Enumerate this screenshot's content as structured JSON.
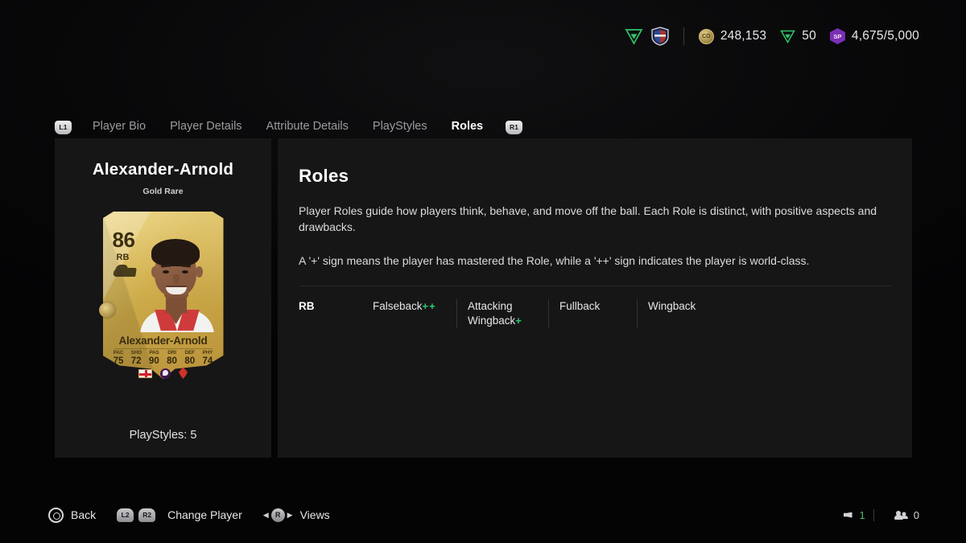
{
  "topbar": {
    "club_points_icon": "fc-points-triangle-icon",
    "club_crest_icon": "club-crest-icon",
    "currencies": [
      {
        "icon": "coins-icon",
        "icon_label": "CO",
        "value": "248,153"
      },
      {
        "icon": "fc-points-icon",
        "icon_label": "",
        "value": "50"
      },
      {
        "icon": "season-points-icon",
        "icon_label": "SP",
        "value": "4,675/5,000"
      }
    ]
  },
  "tabs": {
    "left_shoulder": "L1",
    "right_shoulder": "R1",
    "items": [
      {
        "label": "Player Bio",
        "active": false
      },
      {
        "label": "Player Details",
        "active": false
      },
      {
        "label": "Attribute Details",
        "active": false
      },
      {
        "label": "PlayStyles",
        "active": false
      },
      {
        "label": "Roles",
        "active": true
      }
    ]
  },
  "player": {
    "name": "Alexander-Arnold",
    "rarity": "Gold Rare",
    "playstyles_line": "PlayStyles: 5",
    "card": {
      "rating": "86",
      "position": "RB",
      "name": "Alexander-Arnold",
      "stats": [
        {
          "label": "PAC",
          "value": "75"
        },
        {
          "label": "SHO",
          "value": "72"
        },
        {
          "label": "PAS",
          "value": "90"
        },
        {
          "label": "DRI",
          "value": "80"
        },
        {
          "label": "DEF",
          "value": "80"
        },
        {
          "label": "PHY",
          "value": "74"
        }
      ],
      "nation_icon": "england-flag-icon",
      "league_icon": "premier-league-icon",
      "club_icon": "liverpool-crest-icon"
    }
  },
  "roles_panel": {
    "title": "Roles",
    "paragraph_1": "Player Roles guide how players think, behave, and move off the ball. Each Role is distinct, with positive aspects and drawbacks.",
    "paragraph_2": "A '+' sign means the player has mastered the Role, while a '++' sign indicates the player is world-class.",
    "position": "RB",
    "roles": [
      {
        "name": "Falseback",
        "plus": "++"
      },
      {
        "name": "Attacking\nWingback",
        "plus": "+"
      },
      {
        "name": "Fullback",
        "plus": ""
      },
      {
        "name": "Wingback",
        "plus": ""
      }
    ]
  },
  "bottombar": {
    "back_label": "Back",
    "change_player_label": "Change Player",
    "change_player_buttons": [
      "L2",
      "R2"
    ],
    "views_label": "Views",
    "views_stick": "R",
    "views_arrow_left": "◀",
    "views_arrow_right": "▶",
    "voice_count": "1",
    "friends_count": "0"
  },
  "colors": {
    "accent_green": "#2ecc71",
    "panel_bg": "#161617",
    "page_bg": "#050505",
    "gold": "#d8b855",
    "purple": "#7b2fb5"
  }
}
